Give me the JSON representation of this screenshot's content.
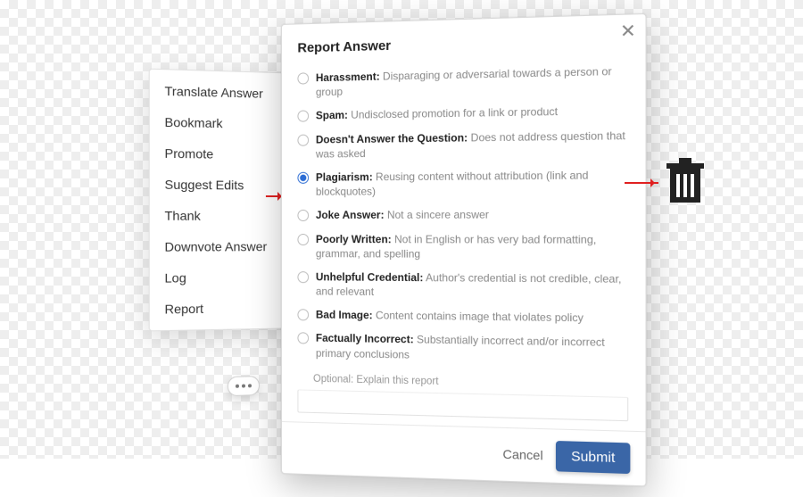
{
  "menu": {
    "items": [
      "Translate Answer",
      "Bookmark",
      "Promote",
      "Suggest Edits",
      "Thank",
      "Downvote Answer",
      "Log",
      "Report"
    ]
  },
  "dialog": {
    "title": "Report Answer",
    "close_glyph": "✕",
    "options": [
      {
        "label": "Harassment:",
        "desc": "Disparaging or adversarial towards a person or group",
        "selected": false
      },
      {
        "label": "Spam:",
        "desc": "Undisclosed promotion for a link or product",
        "selected": false
      },
      {
        "label": "Doesn't Answer the Question:",
        "desc": "Does not address question that was asked",
        "selected": false
      },
      {
        "label": "Plagiarism:",
        "desc": "Reusing content without attribution (link and blockquotes)",
        "selected": true
      },
      {
        "label": "Joke Answer:",
        "desc": "Not a sincere answer",
        "selected": false
      },
      {
        "label": "Poorly Written:",
        "desc": "Not in English or has very bad formatting, grammar, and spelling",
        "selected": false
      },
      {
        "label": "Unhelpful Credential:",
        "desc": "Author's credential is not credible, clear, and relevant",
        "selected": false
      },
      {
        "label": "Bad Image:",
        "desc": "Content contains image that violates policy",
        "selected": false
      },
      {
        "label": "Factually Incorrect:",
        "desc": "Substantially incorrect and/or incorrect primary conclusions",
        "selected": false
      }
    ],
    "optional_hint": "Optional: Explain this report",
    "cancel": "Cancel",
    "submit": "Submit"
  }
}
